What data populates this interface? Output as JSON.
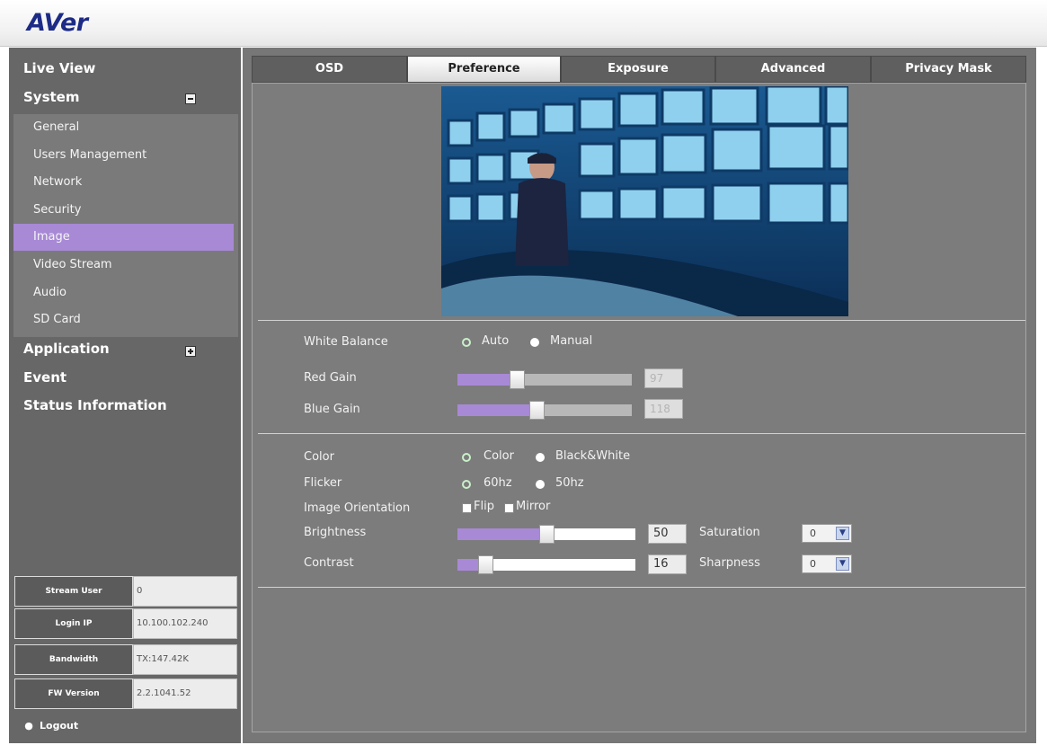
{
  "brand": {
    "logo_text": "AVer"
  },
  "sidebar": {
    "top_items": [
      "Live View",
      "System",
      "Application",
      "Event",
      "Status Information"
    ],
    "system_sub_items": [
      "General",
      "Users Management",
      "Network",
      "Security",
      "Image",
      "Video Stream",
      "Audio",
      "SD Card"
    ],
    "active_sub_item": "Image",
    "info": [
      {
        "label": "Stream User",
        "value": "0"
      },
      {
        "label": "Login IP",
        "value": "10.100.102.240"
      },
      {
        "label": "Bandwidth",
        "value": "TX:147.42K"
      },
      {
        "label": "FW Version",
        "value": "2.2.1041.52"
      }
    ],
    "logout_label": "Logout",
    "logout_icon": "user-icon"
  },
  "tabs": [
    "OSD",
    "Preference",
    "Exposure",
    "Advanced",
    "Privacy Mask"
  ],
  "active_tab": "Preference",
  "white_balance": {
    "label": "White Balance",
    "options": [
      "Auto",
      "Manual"
    ],
    "selected": "Auto",
    "red_gain": {
      "label": "Red Gain",
      "value": "97"
    },
    "blue_gain": {
      "label": "Blue Gain",
      "value": "118"
    }
  },
  "color": {
    "label": "Color",
    "options": [
      "Color",
      "Black&White"
    ],
    "selected": "Color"
  },
  "flicker": {
    "label": "Flicker",
    "options": [
      "60hz",
      "50hz"
    ],
    "selected": "60hz"
  },
  "orientation": {
    "label": "Image Orientation",
    "flip_label": "Flip",
    "mirror_label": "Mirror"
  },
  "brightness": {
    "label": "Brightness",
    "value": "50"
  },
  "contrast": {
    "label": "Contrast",
    "value": "16"
  },
  "saturation": {
    "label": "Saturation",
    "value": "0"
  },
  "sharpness": {
    "label": "Sharpness",
    "value": "0"
  },
  "colors": {
    "accent": "#a889d6",
    "sidebar_bg": "#676767",
    "panel_bg": "#7c7c7c",
    "logo": "#1c2b86"
  }
}
